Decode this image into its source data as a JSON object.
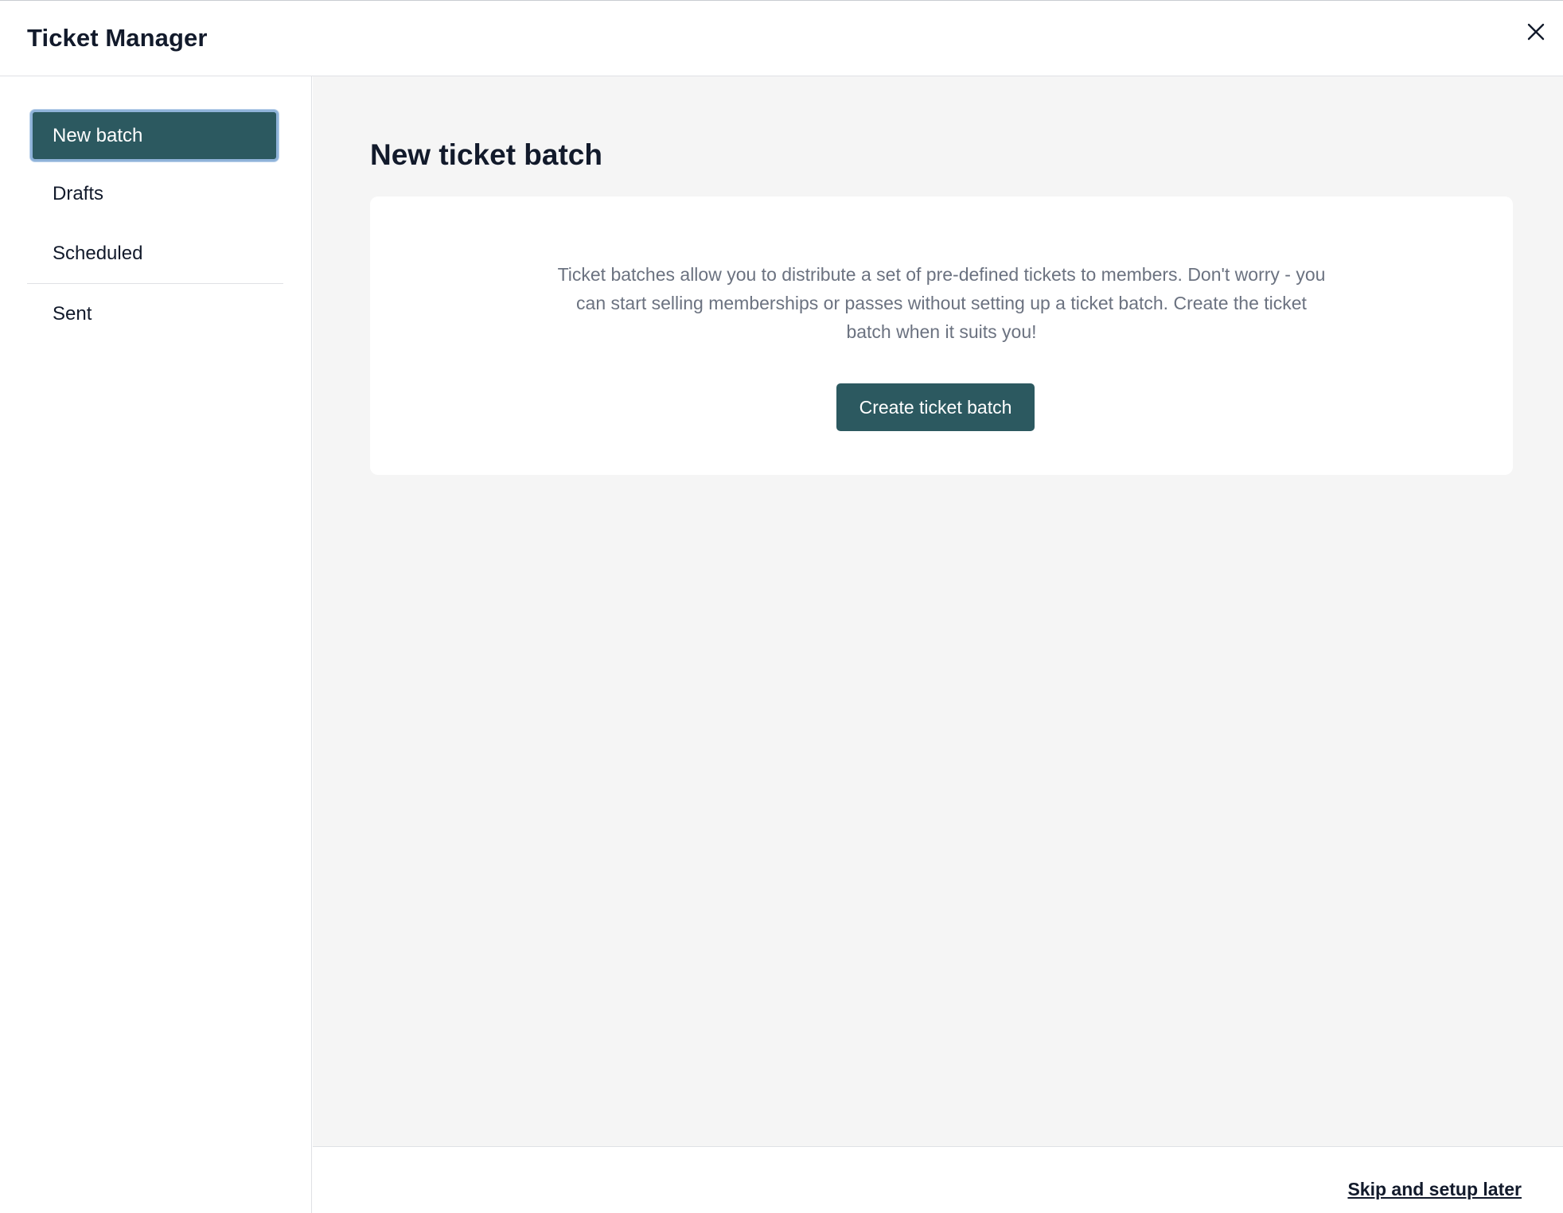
{
  "header": {
    "title": "Ticket Manager",
    "close_icon": "close-icon"
  },
  "sidebar": {
    "items": [
      {
        "label": "New batch",
        "active": true
      },
      {
        "label": "Drafts",
        "active": false
      },
      {
        "label": "Scheduled",
        "active": false
      },
      {
        "label": "Sent",
        "active": false
      }
    ]
  },
  "main": {
    "title": "New ticket batch",
    "card": {
      "description": "Ticket batches allow you to distribute a set of pre-defined tickets to members. Don't worry - you can start selling memberships or passes without setting up a ticket batch. Create the ticket batch when it suits you!",
      "button_label": "Create ticket batch"
    }
  },
  "footer": {
    "skip_label": "Skip and setup later"
  },
  "colors": {
    "accent": "#2c5960",
    "focus_ring": "#8fb3d9",
    "main_bg": "#f5f5f5",
    "muted_text": "#6b7280"
  }
}
